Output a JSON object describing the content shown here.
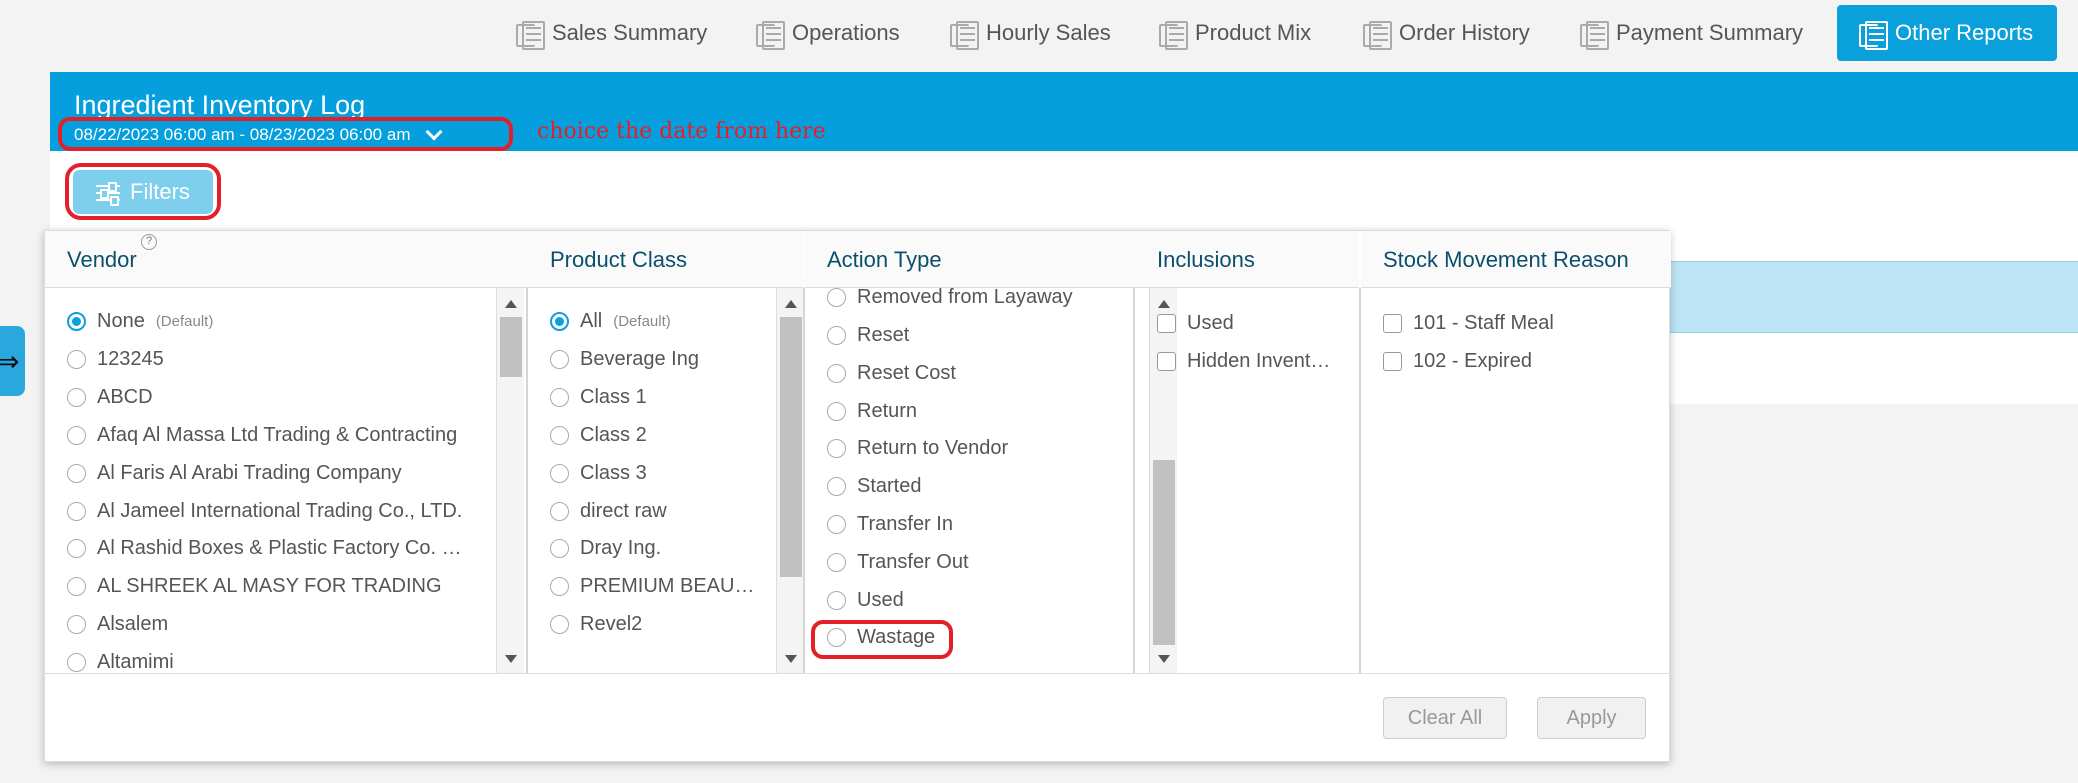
{
  "nav": {
    "items": [
      {
        "label": "Sales Summary",
        "icon": "report-icon"
      },
      {
        "label": "Operations",
        "icon": "report-icon"
      },
      {
        "label": "Hourly Sales",
        "icon": "report-icon"
      },
      {
        "label": "Product Mix",
        "icon": "report-icon"
      },
      {
        "label": "Order History",
        "icon": "report-icon"
      },
      {
        "label": "Payment Summary",
        "icon": "report-icon"
      },
      {
        "label": "Other Reports",
        "icon": "report-icon",
        "active": true
      }
    ]
  },
  "report": {
    "title": "Ingredient Inventory Log",
    "date_range": "08/22/2023 06:00 am - 08/23/2023 06:00 am"
  },
  "annotation": "choice the date from here",
  "filters_button": "Filters",
  "filter_panel": {
    "vendor": {
      "header": "Vendor",
      "help": "?",
      "options": [
        "None",
        "123245",
        "ABCD",
        "Afaq Al Massa Ltd Trading & Contracting",
        "Al Faris Al Arabi Trading Company",
        "Al Jameel International Trading Co., LTD.",
        "Al Rashid Boxes & Plastic Factory Co. …",
        "AL SHREEK AL MASY FOR TRADING",
        "Alsalem",
        "Altamimi"
      ],
      "default_tag": "(Default)",
      "selected": "None"
    },
    "product_class": {
      "header": "Product Class",
      "options": [
        "All",
        "Beverage Ing",
        "Class 1",
        "Class 2",
        "Class 3",
        "direct raw",
        "Dray Ing.",
        "PREMIUM BEAU…",
        "Revel2"
      ],
      "default_tag": "(Default)",
      "selected": "All"
    },
    "action_type": {
      "header": "Action Type",
      "options": [
        "Removed from Layaway",
        "Reset",
        "Reset Cost",
        "Return",
        "Return to Vendor",
        "Started",
        "Transfer In",
        "Transfer Out",
        "Used",
        "Wastage"
      ],
      "highlighted": "Wastage"
    },
    "inclusions": {
      "header": "Inclusions",
      "options": [
        "Used",
        "Hidden Invent…"
      ]
    },
    "stock_movement_reason": {
      "header": "Stock Movement Reason",
      "options": [
        "101 - Staff Meal",
        "102 - Expired"
      ]
    },
    "clear_all": "Clear All",
    "apply": "Apply"
  },
  "side_tab_icon": "expand-arrow-icon",
  "colors": {
    "accent": "#069fde",
    "annotation": "#e32028",
    "filters_button": "#7ecfee"
  }
}
